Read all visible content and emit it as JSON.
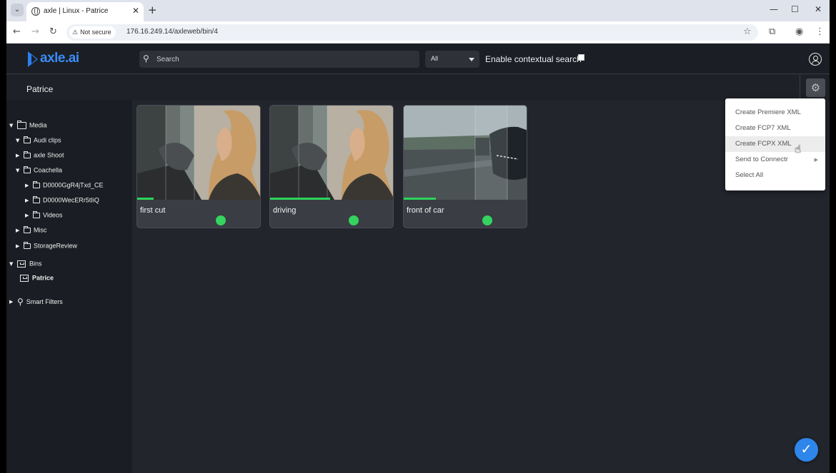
{
  "browser": {
    "tab_title": "axle | Linux - Patrice",
    "tab_close": "✕",
    "new_tab": "+",
    "security_label": "Not secure",
    "url": "176.16.249.14/axleweb/bin/4"
  },
  "header": {
    "logo_text": "axle.ai",
    "search_placeholder": "Search",
    "scope_value": "All",
    "contextual_label": "Enable contextual search"
  },
  "subheader": {
    "title": "Patrice"
  },
  "sidebar": {
    "media": "Media",
    "audi_clips": "Audi clips",
    "axle_shoot": "axle Shoot",
    "coachella": "Coachella",
    "clip1": "D0000GgR4jTxd_CE",
    "clip2": "D0000WecERr5tIiQ",
    "videos": "Videos",
    "misc": "Misc",
    "storage_review": "StorageReview",
    "bins": "Bins",
    "bin_patrice": "Patrice",
    "smart_filters": "Smart Filters"
  },
  "cards": [
    {
      "title": "first cut",
      "progress": 0.13,
      "status_color": "#35d35f"
    },
    {
      "title": "driving",
      "progress": 0.48,
      "status_color": "#35d35f"
    },
    {
      "title": "front of car",
      "progress": 0.26,
      "status_color": "#35d35f"
    }
  ],
  "menu": {
    "items": [
      "Create Premiere XML",
      "Create FCP7 XML",
      "Create FCPX XML",
      "Send to Connectr",
      "Select All"
    ]
  },
  "colors": {
    "accent": "#2f86ea",
    "progress": "#2bd45a"
  }
}
